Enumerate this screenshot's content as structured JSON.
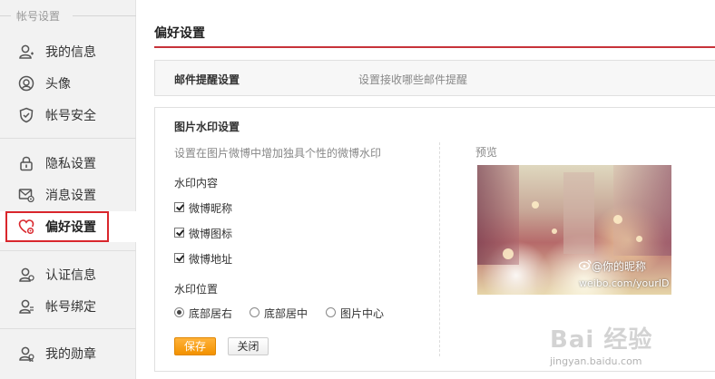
{
  "sidebar": {
    "header": "帐号设置",
    "items": [
      {
        "label": "我的信息",
        "icon": "user-icon"
      },
      {
        "label": "头像",
        "icon": "avatar-icon"
      },
      {
        "label": "帐号安全",
        "icon": "shield-icon"
      },
      {
        "label": "隐私设置",
        "icon": "lock-icon"
      },
      {
        "label": "消息设置",
        "icon": "message-icon"
      },
      {
        "label": "偏好设置",
        "icon": "heart-gear-icon"
      },
      {
        "label": "认证信息",
        "icon": "verify-user-icon"
      },
      {
        "label": "帐号绑定",
        "icon": "bind-user-icon"
      },
      {
        "label": "我的勋章",
        "icon": "medal-icon"
      }
    ],
    "active_index": 5,
    "highlight_color": "#d9262c"
  },
  "main": {
    "title": "偏好设置",
    "mail_panel": {
      "title": "邮件提醒设置",
      "description": "设置接收哪些邮件提醒"
    },
    "watermark_panel": {
      "title": "图片水印设置",
      "description": "设置在图片微博中增加独具个性的微博水印",
      "content_label": "水印内容",
      "checkboxes": [
        {
          "label": "微博昵称",
          "checked": true
        },
        {
          "label": "微博图标",
          "checked": true
        },
        {
          "label": "微博地址",
          "checked": true
        }
      ],
      "position_label": "水印位置",
      "positions": [
        {
          "label": "底部居右",
          "selected": true
        },
        {
          "label": "底部居中",
          "selected": false
        },
        {
          "label": "图片中心",
          "selected": false
        }
      ],
      "save_label": "保存",
      "close_label": "关闭",
      "preview_label": "预览",
      "preview_nickname": "@你的昵称",
      "preview_url": "weibo.com/yourID"
    }
  },
  "page_watermark": {
    "brand": "Bai 经验",
    "url": "jingyan.baidu.com"
  },
  "colors": {
    "accent_red": "#c7333a",
    "save_orange": "#f39200"
  }
}
